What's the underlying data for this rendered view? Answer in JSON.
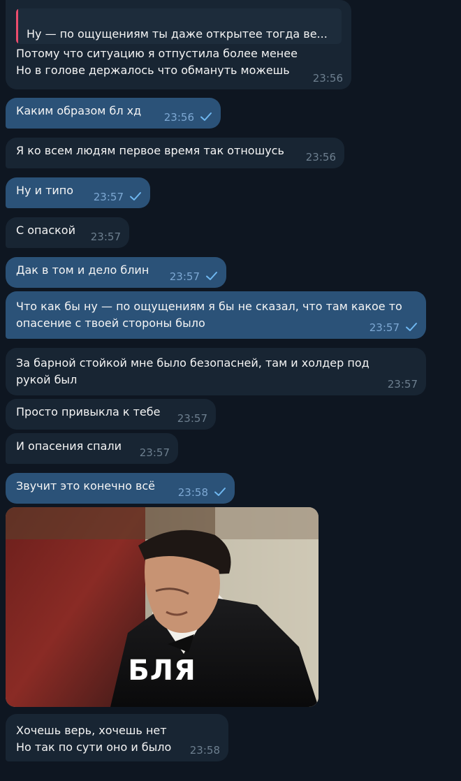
{
  "messages": [
    {
      "reply_text": "Ну — по ощущениям ты даже открытее тогда ве...",
      "text": "Потому что ситуацию я отпустила более менее\nНо в голове держалось что обмануть можешь",
      "time": "23:56"
    },
    {
      "text": "Каким образом бл хд",
      "time": "23:56"
    },
    {
      "text": "Я ко всем людям первое время так отношусь",
      "time": "23:56"
    },
    {
      "text": "Ну и типо",
      "time": "23:57"
    },
    {
      "text": "С опаской",
      "time": "23:57"
    },
    {
      "text": "Дак в том и дело блин",
      "time": "23:57"
    },
    {
      "text": "Что как бы ну — по ощущениям я бы не сказал, что там какое то\nопасение с твоей стороны было",
      "time": "23:57"
    },
    {
      "text": "За барной стойкой мне было безопасней, там и холдер под\nрукой был",
      "time": "23:57"
    },
    {
      "text": "Просто привыкла к тебе",
      "time": "23:57"
    },
    {
      "text": "И опасения спали",
      "time": "23:57"
    },
    {
      "text": "Звучит это конечно всё",
      "time": "23:58"
    },
    {
      "text": "Хочешь верь, хочешь нет\nНо так по сути оно и было",
      "time": "23:58"
    }
  ],
  "gif": {
    "caption": "БЛЯ"
  },
  "colors": {
    "background": "#0e1621",
    "incoming": "#182533",
    "outgoing": "#2b5278",
    "reply_accent": "#ec4c6d"
  }
}
